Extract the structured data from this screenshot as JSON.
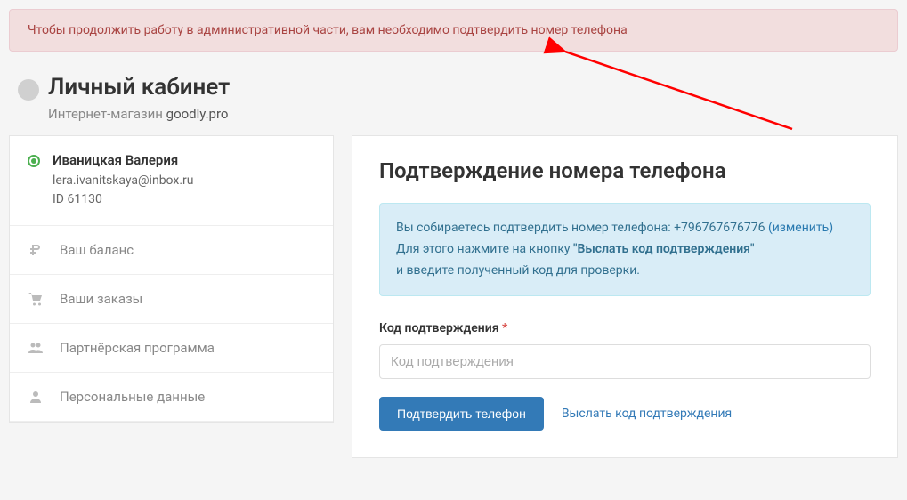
{
  "alert": {
    "text": "Чтобы продолжить работу в административной части, вам необходимо подтвердить номер телефона"
  },
  "header": {
    "title": "Личный кабинет",
    "subtitle_prefix": "Интернет-магазин ",
    "subtitle_domain": "goodly.pro"
  },
  "sidebar": {
    "user": {
      "name": "Иваницкая Валерия",
      "email": "lera.ivanitskaya@inbox.ru",
      "id_label": "ID 61130"
    },
    "items": [
      {
        "icon": "ruble",
        "label": "Ваш баланс"
      },
      {
        "icon": "cart",
        "label": "Ваши заказы"
      },
      {
        "icon": "users",
        "label": "Партнёрская программа"
      },
      {
        "icon": "user",
        "label": "Персональные данные"
      }
    ]
  },
  "main": {
    "title": "Подтверждение номера телефона",
    "info": {
      "line1_prefix": "Вы собираетесь подтвердить номер телефона: ",
      "phone": "+796767676776",
      "change_label": "(изменить)",
      "line2_prefix": "Для этого нажмите на кнопку ",
      "line2_bold": "\"Выслать код подтверждения\"",
      "line3": "и введите полученный код для проверки."
    },
    "form": {
      "label": "Код подтверждения",
      "required_mark": "*",
      "placeholder": "Код подтверждения",
      "submit_label": "Подтвердить телефон",
      "resend_label": "Выслать код подтверждения"
    }
  }
}
